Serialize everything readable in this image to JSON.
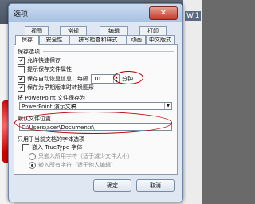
{
  "background": {
    "version_badge": "W.1"
  },
  "dialog": {
    "title": "选项",
    "close_label": "✕",
    "tabs": [
      "视图",
      "常规",
      "编辑",
      "打印",
      "保存",
      "安全性",
      "拼写检查和样式",
      "动画",
      "中文版式"
    ],
    "panel": {
      "save_options_label": "保存选项",
      "allow_fast_save": "允许快速保存",
      "prompt_file_props": "提示保存文件属性",
      "autosave_prefix": "保存自动恢复信息，每隔",
      "autosave_minutes": "10",
      "autosave_unit": "分钟",
      "convert_on_save": "保存为早期版本时转换图形",
      "save_as_label": "将 PowerPoint 文件保存为",
      "save_as_value": "PowerPoint 演示文稿",
      "default_location_label": "默认文件位置",
      "default_location_value": "C:\\Users\\acer\\Documents\\",
      "font_section_label": "只用于当前文档的字体选项",
      "embed_truetype": "嵌入 TrueType 字体",
      "embed_used_only": "只嵌入所用字符（适于减少文件大小）",
      "embed_all": "嵌入所有字符（适于他人编辑）"
    },
    "ok_label": "确定",
    "cancel_label": "取消"
  }
}
